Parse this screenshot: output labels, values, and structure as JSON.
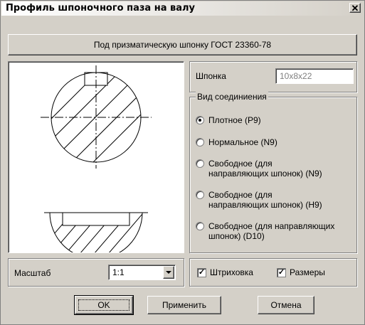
{
  "window": {
    "title": "Профиль шпоночного паза на валу",
    "close_glyph": "✕"
  },
  "header": {
    "text": "Под призматическую шпонку ГОСТ 23360-78"
  },
  "key": {
    "label": "Шпонка",
    "value": "10x8x22"
  },
  "connection": {
    "legend": "Вид соединиения",
    "options": [
      {
        "label": "Плотное (P9)",
        "checked": true
      },
      {
        "label": "Нормальное (N9)",
        "checked": false
      },
      {
        "label_line1": "Свободное (для",
        "label_line2": "направляющих шпонок) (N9)",
        "checked": false
      },
      {
        "label_line1": "Свободное (для",
        "label_line2": "направляющих шпонок) (H9)",
        "checked": false
      },
      {
        "label_line1": "Свободное (для направляющих",
        "label_line2": "шпонок) (D10)",
        "checked": false
      }
    ]
  },
  "scale": {
    "label": "Масштаб",
    "value": "1:1"
  },
  "checks": {
    "hatching": "Штриховка",
    "dimensions": "Размеры",
    "hatching_checked": true,
    "dimensions_checked": true
  },
  "buttons": {
    "ok": "OK",
    "apply": "Применить",
    "cancel": "Отмена"
  }
}
